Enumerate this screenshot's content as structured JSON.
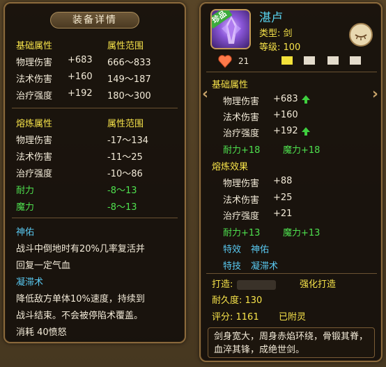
{
  "left": {
    "title": "装备详情",
    "base": {
      "header_attr": "基础属性",
      "header_range": "属性范围",
      "rows": [
        {
          "name": "物理伤害",
          "value": "+683",
          "range": "666～833"
        },
        {
          "name": "法术伤害",
          "value": "+160",
          "range": "149～187"
        },
        {
          "name": "治疗强度",
          "value": "+192",
          "range": "180～300"
        }
      ]
    },
    "smelt": {
      "header_attr": "熔炼属性",
      "header_range": "属性范围",
      "rows": [
        {
          "name": "物理伤害",
          "range": "-17～134"
        },
        {
          "name": "法术伤害",
          "range": "-11～25"
        },
        {
          "name": "治疗强度",
          "range": "-10～86"
        },
        {
          "name": "耐力",
          "range": "-8～13"
        },
        {
          "name": "魔力",
          "range": "-8～13"
        }
      ]
    },
    "skill1": {
      "name": "神佑",
      "desc1": "战斗中倒地时有20%几率复活并",
      "desc2": "回复一定气血"
    },
    "skill2": {
      "name": "凝滞术",
      "desc1": "降低敌方单体10%速度，持续到",
      "desc2": "战斗结束。不会被停陷术覆盖。",
      "cost": "消耗 40愤怒"
    }
  },
  "right": {
    "item_name": "湛卢",
    "rare_tag": "珍品",
    "type_line": "类型: 剑",
    "level_line": "等级: 100",
    "hearts": "21",
    "base_title": "基础属性",
    "base_rows": [
      {
        "name": "物理伤害",
        "value": "+683"
      },
      {
        "name": "法术伤害",
        "value": "+160"
      },
      {
        "name": "治疗强度",
        "value": "+192"
      }
    ],
    "base_bonus1": "耐力+18",
    "base_bonus2": "魔力+18",
    "smelt_title": "熔炼效果",
    "smelt_rows": [
      {
        "name": "物理伤害",
        "value": "+88"
      },
      {
        "name": "法术伤害",
        "value": "+25"
      },
      {
        "name": "治疗强度",
        "value": "+21"
      }
    ],
    "smelt_bonus1": "耐力+13",
    "smelt_bonus2": "魔力+13",
    "effect_label": "特效",
    "effect_value": "神佑",
    "skill_label": "特技",
    "skill_value": "凝滞术",
    "maker_label": "打造:",
    "maker_suffix": "强化打造",
    "durability": "耐久度: 130",
    "score": "评分: 1161",
    "spirit": "已附灵",
    "description": "剑身宽大，周身赤焰环绕，骨锻其脊，血淬其锋，成绝世剑。"
  },
  "colors": {
    "yellow": "#f7e34a",
    "green": "#4ee04e",
    "cyan": "#59c8f0",
    "border": "#8b6a3c"
  }
}
